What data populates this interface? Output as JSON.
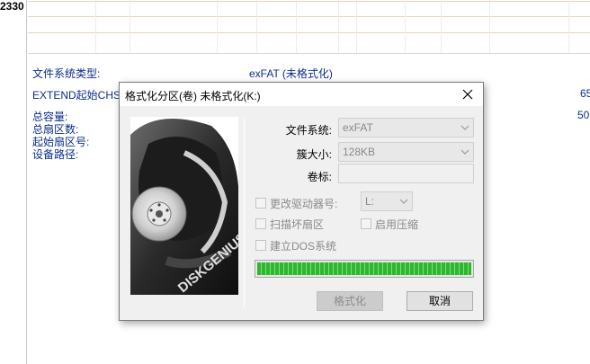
{
  "background": {
    "left_number": "2330",
    "rows": [
      {
        "label": "文件系统类型:",
        "value": "exFAT (未格式化)"
      },
      {
        "label": "EXTEND起始CHS",
        "value": "65"
      },
      {
        "label": "总容量:",
        "value": "50"
      },
      {
        "label": "总扇区数:"
      },
      {
        "label": "起始扇区号:"
      },
      {
        "label": "设备路径:"
      }
    ]
  },
  "dialog": {
    "title": "格式化分区(卷) 未格式化(K:)",
    "image": {
      "brand": "DISKGENIUS"
    },
    "fields": {
      "filesystem_label": "文件系统:",
      "filesystem_value": "exFAT",
      "cluster_label": "簇大小:",
      "cluster_value": "128KB",
      "volume_label": "卷标:",
      "volume_value": ""
    },
    "options": {
      "change_drive_letter": "更改驱动器号:",
      "drive_letter_value": "L:",
      "scan_bad_sectors": "扫描坏扇区",
      "enable_compression": "启用压缩",
      "create_dos": "建立DOS系统"
    },
    "progress": 1.0,
    "buttons": {
      "format": "格式化",
      "cancel": "取消"
    }
  },
  "colors": {
    "info_text": "#0a2f8a",
    "progress_green": "#2fb62f"
  }
}
